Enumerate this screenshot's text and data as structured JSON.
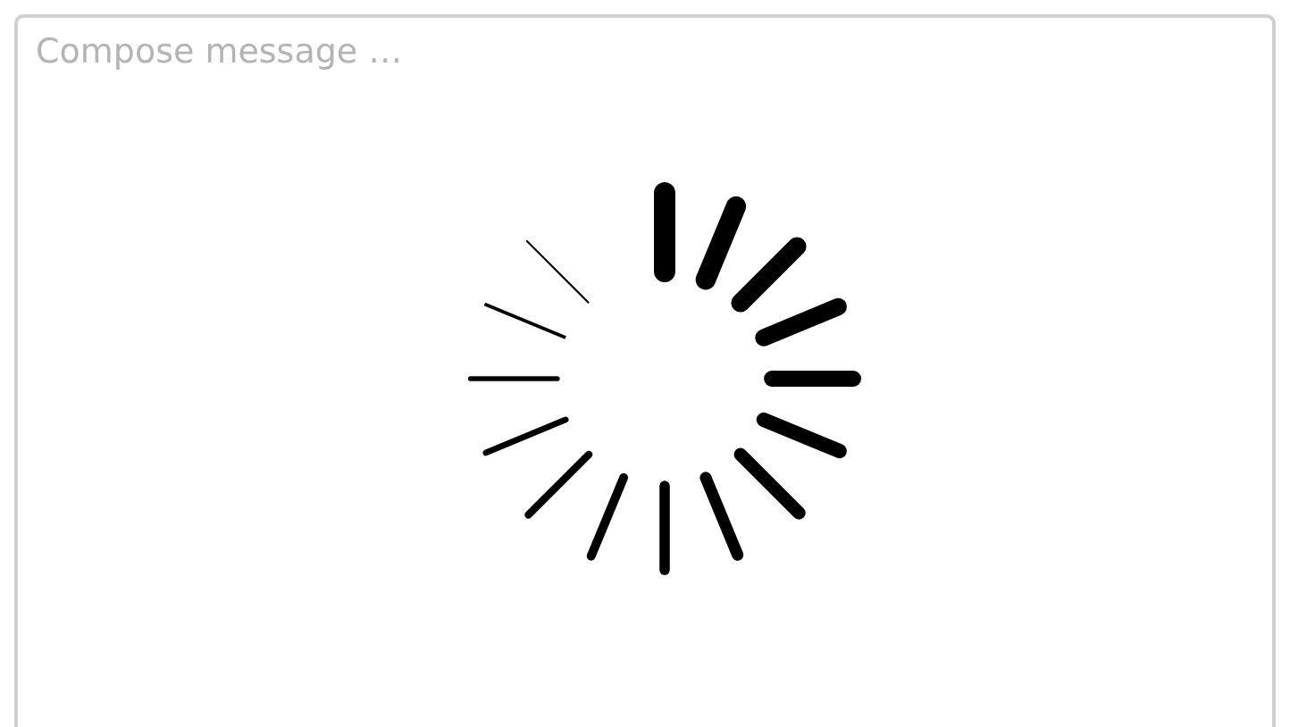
{
  "compose": {
    "placeholder": "Compose message …"
  }
}
